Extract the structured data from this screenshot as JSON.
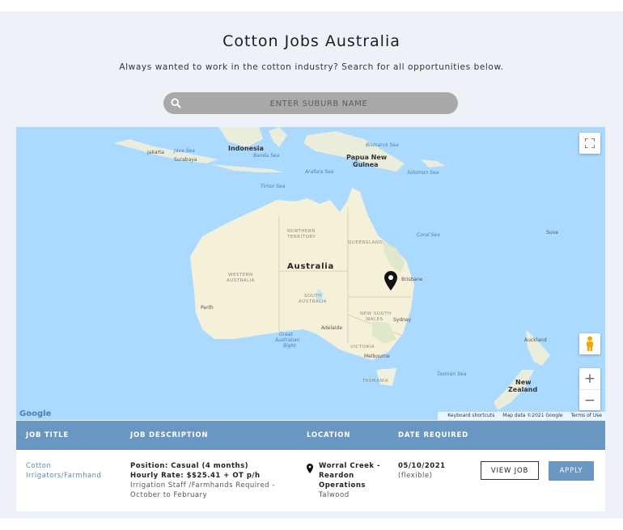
{
  "header": {
    "title": "Cotton Jobs Australia",
    "subtitle": "Always wanted to work in the cotton industry? Search for all opportunities below."
  },
  "search": {
    "placeholder": "ENTER SUBURB NAME",
    "value": ""
  },
  "map": {
    "labels": {
      "indonesia": "Indonesia",
      "papua": "Papua New",
      "guinea": "Guinea",
      "australia": "Australia",
      "new_zealand_1": "New",
      "new_zealand_2": "Zealand",
      "northern_territory_1": "NORTHERN",
      "northern_territory_2": "TERRITORY",
      "queensland": "QUEENSLAND",
      "western_australia_1": "WESTERN",
      "western_australia_2": "AUSTRALIA",
      "south_australia_1": "SOUTH",
      "south_australia_2": "AUSTRALIA",
      "nsw_1": "NEW SOUTH",
      "nsw_2": "WALES",
      "victoria": "VICTORIA",
      "tasmania": "TASMANIA",
      "jakarta": "Jakarta",
      "surabaya": "Surabaya",
      "java_sea": "Java Sea",
      "banda_sea": "Banda Sea",
      "bismarck_sea": "Bismarck Sea",
      "solomon_sea": "Solomon Sea",
      "arafura_sea": "Arafura Sea",
      "timor_sea": "Timor Sea",
      "coral_sea": "Coral Sea",
      "tasman_sea": "Tasman Sea",
      "great_australian_bight_1": "Great",
      "great_australian_bight_2": "Australian",
      "great_australian_bight_3": "Bight",
      "brisbane": "Brisbane",
      "sydney": "Sydney",
      "adelaide": "Adelaide",
      "melbourne": "Melbourne",
      "perth": "Perth",
      "auckland": "Auckland",
      "suva": "Suva"
    },
    "attribution": {
      "shortcuts": "Keyboard shortcuts",
      "mapdata": "Map data ©2021 Google",
      "terms": "Terms of Use"
    },
    "logo": "Google",
    "zoom_in": "+",
    "zoom_out": "−",
    "icons": {
      "fullscreen": "fullscreen-icon",
      "pegman": "pegman-icon",
      "marker": "map-marker-icon"
    }
  },
  "table": {
    "headers": {
      "title": "JOB TITLE",
      "description": "JOB DESCRIPTION",
      "location": "LOCATION",
      "date": "DATE REQUIRED"
    },
    "rows": [
      {
        "title_line1": "Cotton",
        "title_line2": "Irrigators/Farmhand",
        "position": "Position: Casual (4 months)",
        "rate": "Hourly Rate: $$25.41 + OT p/h",
        "desc_line1": "Irrigation Staff /Farmhands Required -",
        "desc_line2": "October to February",
        "loc_line1": "Worral Creek -",
        "loc_line2": "Reardon",
        "loc_line3": "Operations",
        "loc_town": "Talwood",
        "date": "05/10/2021",
        "date_note": "(flexible)",
        "view_label": "VIEW JOB",
        "apply_label": "APPLY"
      }
    ]
  },
  "colors": {
    "accent": "#6a97c1",
    "water": "#aadaff",
    "land": "#f5f0d8",
    "search_bg": "#a9a9a9"
  }
}
